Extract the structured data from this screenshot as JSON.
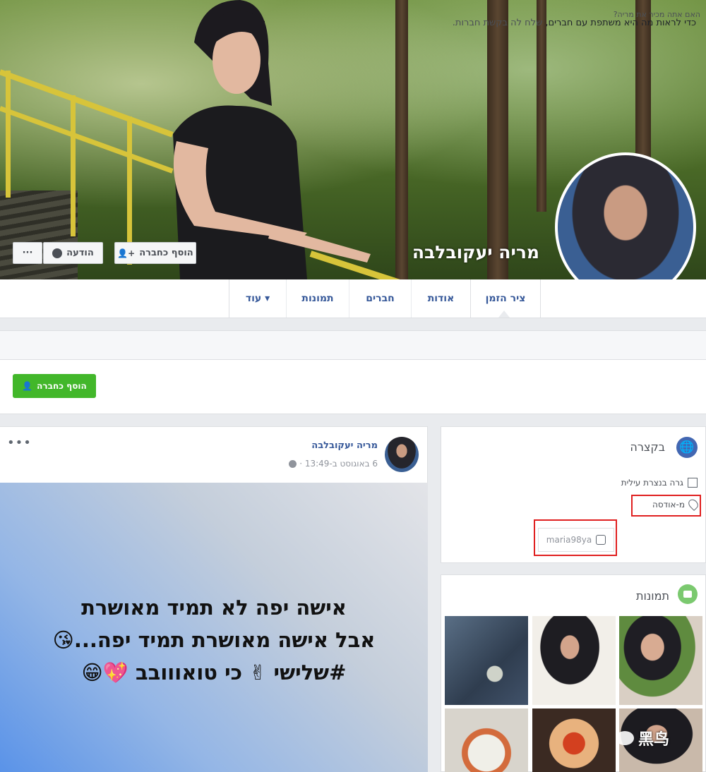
{
  "profile": {
    "name": "מריה יעקובלבה"
  },
  "cover_buttons": {
    "add_friend": "הוסף כחברה",
    "message": "הודעה",
    "more": "···"
  },
  "tabs": [
    {
      "label": "ציר הזמן",
      "active": true
    },
    {
      "label": "אודות"
    },
    {
      "label": "חברים"
    },
    {
      "label": "תמונות"
    },
    {
      "label": "עוד ▾"
    }
  ],
  "know_prompt": "האם אתה מכיר את מריה?",
  "friend_request": {
    "text_prefix": "כדי לראות מה היא משתפת עם חברים,",
    "text_link": "שלח לה בקשת חברות.",
    "button": "הוסף כחברה"
  },
  "post": {
    "author": "מריה יעקובלבה",
    "meta": "6 באוגוסט ב-13:49 ·",
    "more": "•••",
    "lines": [
      "אישה יפה לא תמיד מאושרת",
      "אבל אישה מאושרת תמיד יפה...😘",
      "#שלישי ✌ כי טואווובב 💖😁"
    ],
    "background_colors": [
      "#e3e4e8",
      "#5a93e8"
    ]
  },
  "intro": {
    "title": "בקצרה",
    "lives_in": "גרה בנצרת עילית",
    "from": "מ-אודסה",
    "instagram": "maria98ya"
  },
  "photos": {
    "title": "תמונות",
    "count_visible": 6
  },
  "watermark": "黑鸟",
  "colors": {
    "link": "#365899",
    "green": "#42b72a",
    "highlight_box": "#e02020",
    "page_bg": "#e9ebee"
  }
}
